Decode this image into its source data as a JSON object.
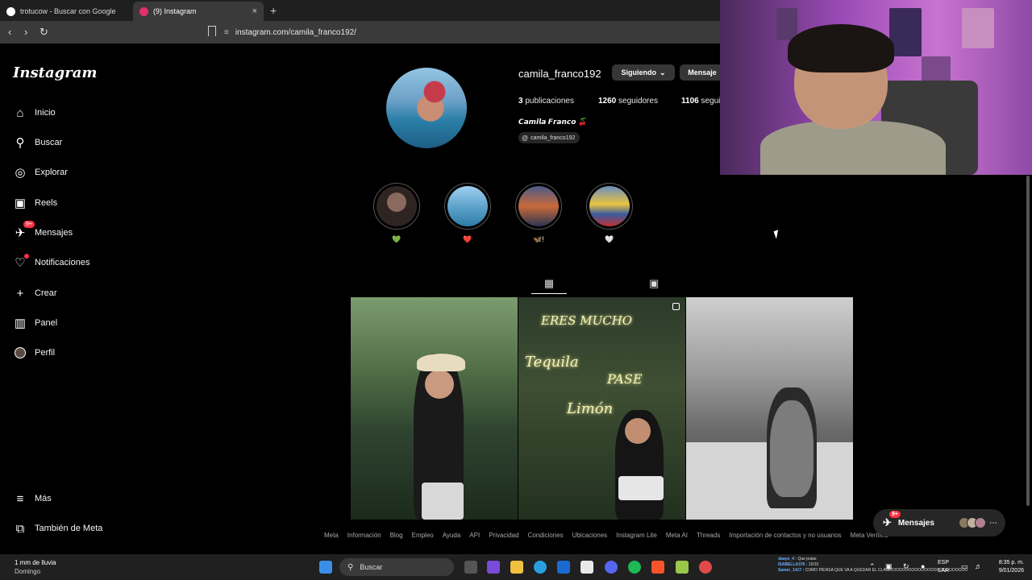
{
  "browser": {
    "tabs": [
      {
        "title": "trotucow - Buscar con Google",
        "active": false,
        "favicon_color": "#ffffff"
      },
      {
        "title": "(9) Instagram",
        "active": true,
        "favicon_color": "#e1306c"
      }
    ],
    "new_tab_label": "+",
    "close_label": "×",
    "url": "instagram.com/camila_franco192/"
  },
  "sidebar": {
    "logo": "Instagram",
    "items": [
      {
        "label": "Inicio",
        "icon": "home-icon",
        "glyph": "⌂"
      },
      {
        "label": "Buscar",
        "icon": "search-icon",
        "glyph": "⚲"
      },
      {
        "label": "Explorar",
        "icon": "compass-icon",
        "glyph": "◎"
      },
      {
        "label": "Reels",
        "icon": "reels-icon",
        "glyph": "▣"
      },
      {
        "label": "Mensajes",
        "icon": "messenger-icon",
        "glyph": "✈",
        "badge": "9+"
      },
      {
        "label": "Notificaciones",
        "icon": "heart-icon",
        "glyph": "♡",
        "dot": true
      },
      {
        "label": "Crear",
        "icon": "plus-icon",
        "glyph": "+"
      },
      {
        "label": "Panel",
        "icon": "chart-icon",
        "glyph": "▥"
      },
      {
        "label": "Perfil",
        "icon": "avatar-icon",
        "glyph": "●"
      }
    ],
    "bottom_items": [
      {
        "label": "Más",
        "icon": "menu-icon",
        "glyph": "≡"
      },
      {
        "label": "También de Meta",
        "icon": "meta-icon",
        "glyph": "⧉"
      }
    ]
  },
  "profile": {
    "username": "camila_franco192",
    "follow_button": "Siguiendo",
    "message_button": "Mensaje",
    "posts_count": "3",
    "posts_label": "publicaciones",
    "followers_count": "1260",
    "followers_label": "seguidores",
    "following_count": "1106",
    "following_label": "segui",
    "full_name": "𝘾𝙖𝙢𝙞𝙡𝙖 𝙁𝙧𝙖𝙣𝙘𝙤 🍒",
    "threads_handle": "camila_franco192"
  },
  "highlights": [
    {
      "label": "💚",
      "color": "#3a2e2c"
    },
    {
      "label": "❤️",
      "color": "#5aa0c8"
    },
    {
      "label": "🦋!",
      "color": "#c86a3a"
    },
    {
      "label": "🤍",
      "color": "#4a6ea0"
    }
  ],
  "posts": [
    {
      "type": "photo"
    },
    {
      "type": "reel",
      "neon_lines": [
        "ERES MUCHO",
        "Tequila",
        "PASE",
        "Limón"
      ]
    },
    {
      "type": "photo"
    }
  ],
  "footer_links": [
    "Meta",
    "Información",
    "Blog",
    "Empleo",
    "Ayuda",
    "API",
    "Privacidad",
    "Condiciones",
    "Ubicaciones",
    "Instagram Lite",
    "Meta AI",
    "Threads",
    "Importación de contactos y no usuarios",
    "Meta Verified"
  ],
  "floating_messages": {
    "label": "Mensajes",
    "badge": "9+"
  },
  "taskbar": {
    "weather_line1": "1 mm de lluvia",
    "weather_line2": "Domingo",
    "search_placeholder": "Buscar",
    "lang_top": "ESP",
    "lang_bottom": "LAA",
    "time": "8:35 p. m.",
    "date": "9/01/2026",
    "chat": [
      {
        "name": "daayo_4 :",
        "text": "Que putas"
      },
      {
        "name": "ISABELLA376 :",
        "text": "10/10"
      },
      {
        "name": "Samer_1417 :",
        "text": "COMO PIENSA QUE VA A QUEDAR EL CLASICOOOOOOOOOOOOOOOOOOOOOOOO"
      }
    ]
  }
}
